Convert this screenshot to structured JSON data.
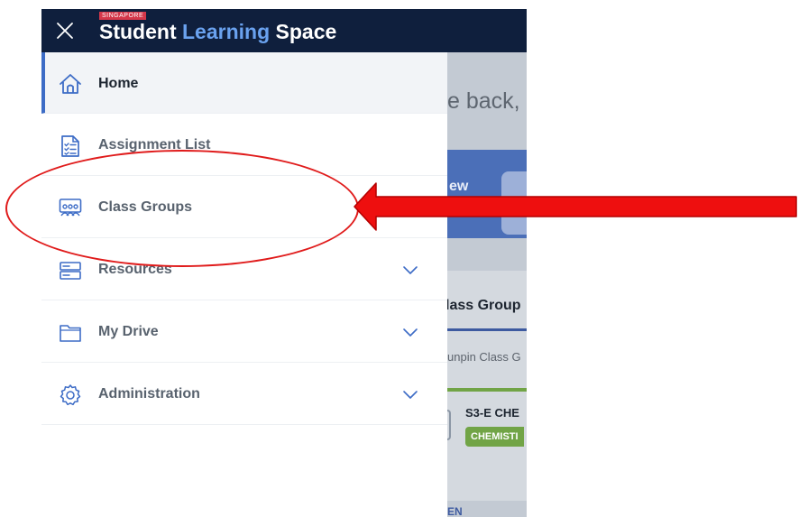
{
  "header": {
    "close_icon": "close-icon",
    "brand_tag": "SINGAPORE",
    "brand_word1": "Student",
    "brand_word2": "Learning",
    "brand_word3": "Space"
  },
  "drawer": {
    "items": [
      {
        "label": "Home",
        "icon": "home-icon",
        "active": true,
        "expandable": false
      },
      {
        "label": "Assignment List",
        "icon": "assignment-list-icon",
        "active": false,
        "expandable": false
      },
      {
        "label": "Class Groups",
        "icon": "class-groups-icon",
        "active": false,
        "expandable": false
      },
      {
        "label": "Resources",
        "icon": "resources-icon",
        "active": false,
        "expandable": true
      },
      {
        "label": "My Drive",
        "icon": "folder-icon",
        "active": false,
        "expandable": true
      },
      {
        "label": "Administration",
        "icon": "gear-icon",
        "active": false,
        "expandable": true
      }
    ]
  },
  "background": {
    "welcome": "e back,",
    "banner_text": "ew",
    "class_group_title": "lass Group",
    "class_group_sub": "unpin Class G",
    "class_name": "S3-E CHE",
    "subject_badge": "CHEMISTI",
    "bottom_link": "EN"
  },
  "colors": {
    "header_bg": "#0f1f3d",
    "brand_accent": "#6aa2ef",
    "active_indicator": "#3d6cc6",
    "icon_blue": "#3d6cc6",
    "annotation_red": "#e01b1b"
  }
}
